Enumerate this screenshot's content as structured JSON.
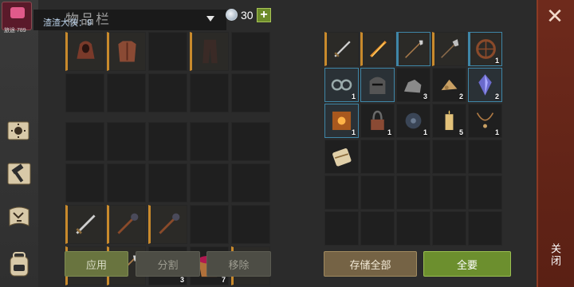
{
  "header": {
    "panel_title": "物品栏",
    "player_name": "渣渣大侠：9",
    "avatar_sub": "旅途 789",
    "currency_value": "30",
    "add_label": "+"
  },
  "buttons": {
    "apply": "应用",
    "split": "分割",
    "remove": "移除",
    "store_all": "存储全部",
    "all": "全要"
  },
  "close": {
    "x": "✕",
    "label": "关闭"
  },
  "inventory_top": [
    {
      "icon": "hood-icon",
      "count": ""
    },
    {
      "icon": "leather-armor-icon",
      "count": ""
    },
    {
      "icon": "",
      "count": ""
    },
    {
      "icon": "pants-icon",
      "count": ""
    },
    {
      "icon": "",
      "count": ""
    },
    {
      "icon": "",
      "count": ""
    },
    {
      "icon": "",
      "count": ""
    },
    {
      "icon": "",
      "count": ""
    },
    {
      "icon": "",
      "count": ""
    },
    {
      "icon": "",
      "count": ""
    }
  ],
  "inventory_bottom": [
    {
      "icon": "",
      "count": ""
    },
    {
      "icon": "",
      "count": ""
    },
    {
      "icon": "",
      "count": ""
    },
    {
      "icon": "",
      "count": ""
    },
    {
      "icon": "",
      "count": ""
    },
    {
      "icon": "",
      "count": ""
    },
    {
      "icon": "",
      "count": ""
    },
    {
      "icon": "",
      "count": ""
    },
    {
      "icon": "",
      "count": ""
    },
    {
      "icon": "",
      "count": ""
    },
    {
      "icon": "sword-icon",
      "count": ""
    },
    {
      "icon": "mace-icon",
      "count": ""
    },
    {
      "icon": "mace-icon",
      "count": ""
    },
    {
      "icon": "",
      "count": ""
    },
    {
      "icon": "",
      "count": ""
    },
    {
      "icon": "sword-icon",
      "count": ""
    },
    {
      "icon": "spear-icon",
      "count": ""
    },
    {
      "icon": "cloth-icon",
      "count": "3"
    },
    {
      "icon": "bowl-icon",
      "count": "7"
    },
    {
      "icon": "halberd-icon",
      "count": ""
    }
  ],
  "storage": [
    {
      "icon": "sword-icon",
      "count": ""
    },
    {
      "icon": "flame-sword-icon",
      "count": ""
    },
    {
      "icon": "spear-icon",
      "count": ""
    },
    {
      "icon": "halberd-icon",
      "count": ""
    },
    {
      "icon": "wheel-icon",
      "count": "1"
    },
    {
      "icon": "shackles-icon",
      "count": "1"
    },
    {
      "icon": "helmet-icon",
      "count": ""
    },
    {
      "icon": "ore-icon",
      "count": "3"
    },
    {
      "icon": "wood-chips-icon",
      "count": "2"
    },
    {
      "icon": "crystal-icon",
      "count": "2"
    },
    {
      "icon": "book-icon",
      "count": "1"
    },
    {
      "icon": "padlock-icon",
      "count": "1"
    },
    {
      "icon": "mechanism-icon",
      "count": "1"
    },
    {
      "icon": "candle-icon",
      "count": "5"
    },
    {
      "icon": "pendant-icon",
      "count": "1"
    },
    {
      "icon": "scroll-bundle-icon",
      "count": ""
    },
    {
      "icon": "",
      "count": ""
    },
    {
      "icon": "",
      "count": ""
    },
    {
      "icon": "",
      "count": ""
    },
    {
      "icon": "",
      "count": ""
    },
    {
      "icon": "",
      "count": ""
    },
    {
      "icon": "",
      "count": ""
    },
    {
      "icon": "",
      "count": ""
    },
    {
      "icon": "",
      "count": ""
    },
    {
      "icon": "",
      "count": ""
    },
    {
      "icon": "",
      "count": ""
    },
    {
      "icon": "",
      "count": ""
    },
    {
      "icon": "",
      "count": ""
    },
    {
      "icon": "",
      "count": ""
    },
    {
      "icon": "",
      "count": ""
    }
  ],
  "sidebar": [
    {
      "icon": "sun-book-icon"
    },
    {
      "icon": "hammer-icon"
    },
    {
      "icon": "map-scroll-icon"
    },
    {
      "icon": "backpack-icon"
    }
  ]
}
